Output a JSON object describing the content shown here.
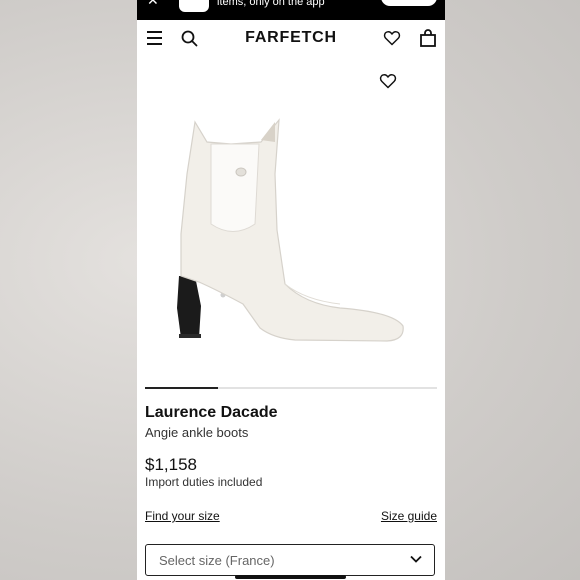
{
  "banner": {
    "text": "items, only on the app"
  },
  "header": {
    "logo": "FARFETCH"
  },
  "icons": {
    "menu": "menu-icon",
    "search": "search-icon",
    "wishlist": "heart-icon",
    "bag": "shopping-bag-icon",
    "dropdown": "chevron-down-icon"
  },
  "gallery": {
    "image_count_indicator": "1 of 4",
    "active_index": 1,
    "total": 4
  },
  "product": {
    "brand": "Laurence Dacade",
    "name": "Angie ankle boots",
    "price": "$1,158",
    "duties": "Import duties included"
  },
  "links": {
    "find_size": "Find your size",
    "size_guide": "Size guide"
  },
  "size_select": {
    "placeholder": "Select size (France)"
  },
  "colors": {
    "brand_black": "#111111",
    "boot_white": "#f2efe9",
    "heel_black": "#1b1b1b"
  }
}
